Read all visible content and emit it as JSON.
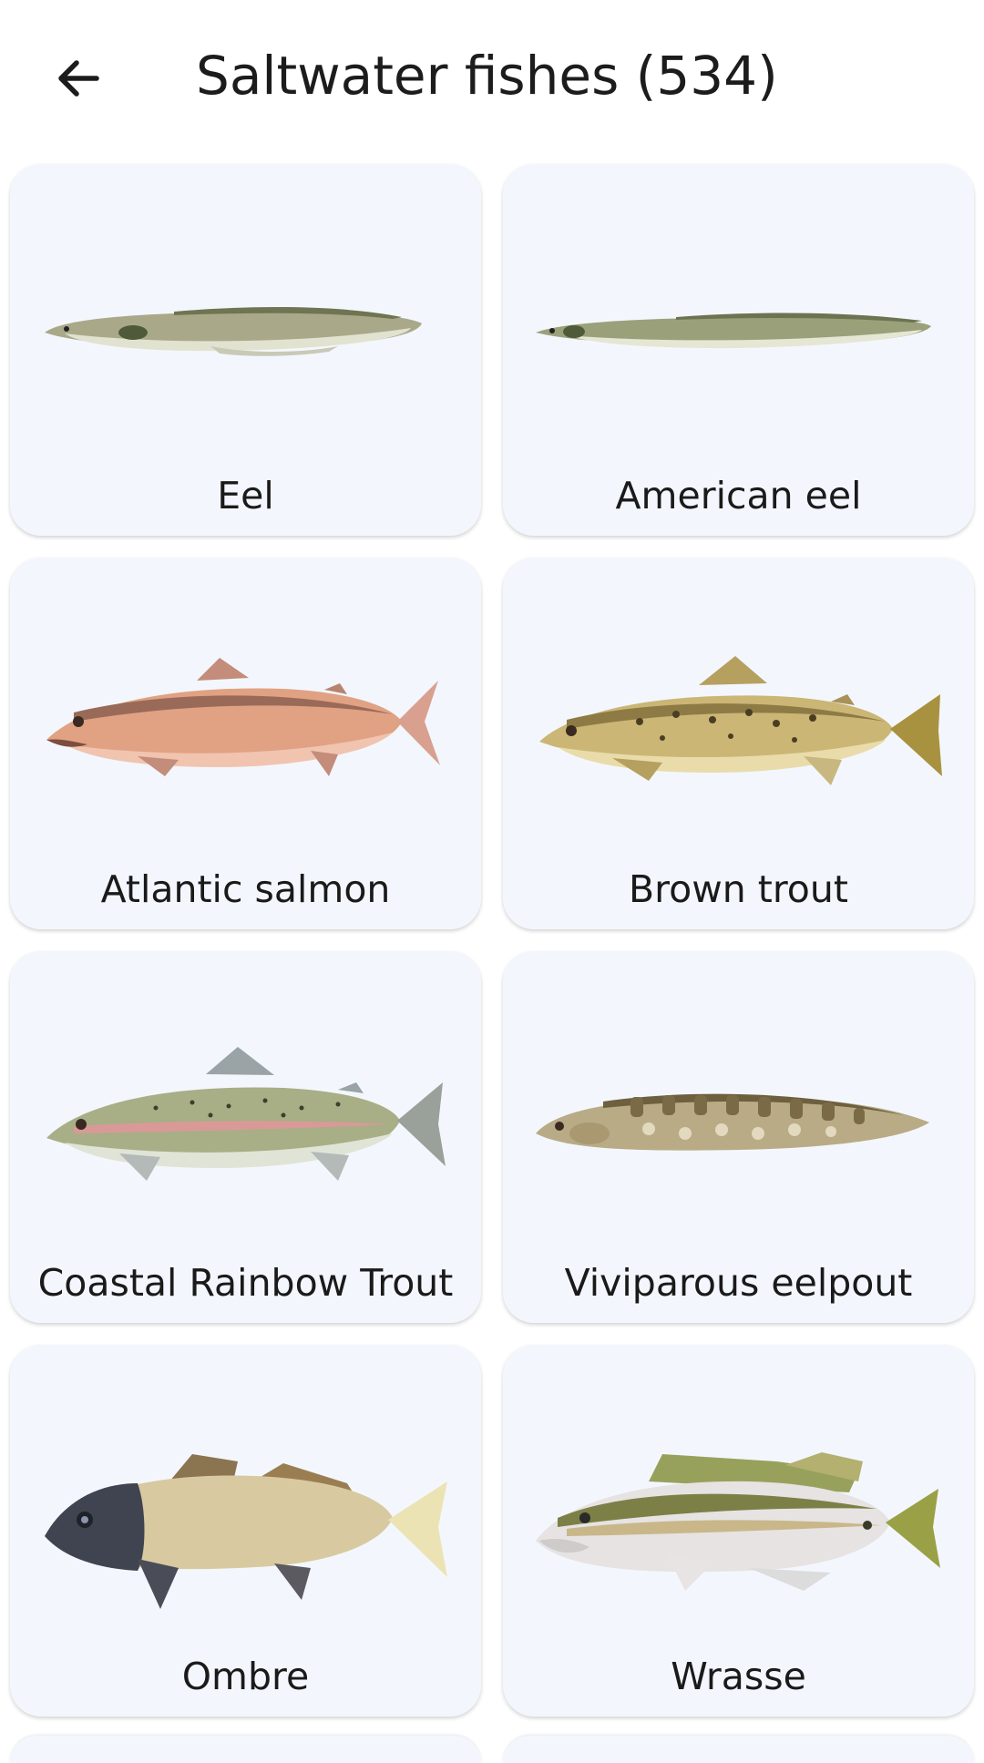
{
  "header": {
    "title": "Saltwater fishes (534)"
  },
  "colors": {
    "card_bg": "#f3f7fd",
    "text": "#1a1a1a"
  },
  "cards": [
    {
      "label": "Eel",
      "icon": "eel-illustration"
    },
    {
      "label": "American eel",
      "icon": "american-eel-illustration"
    },
    {
      "label": "Atlantic salmon",
      "icon": "atlantic-salmon-illustration"
    },
    {
      "label": "Brown trout",
      "icon": "brown-trout-illustration"
    },
    {
      "label": "Coastal Rainbow Trout",
      "icon": "coastal-rainbow-trout-illustration"
    },
    {
      "label": "Viviparous eelpout",
      "icon": "viviparous-eelpout-illustration"
    },
    {
      "label": "Ombre",
      "icon": "ombre-illustration"
    },
    {
      "label": "Wrasse",
      "icon": "wrasse-illustration"
    }
  ]
}
